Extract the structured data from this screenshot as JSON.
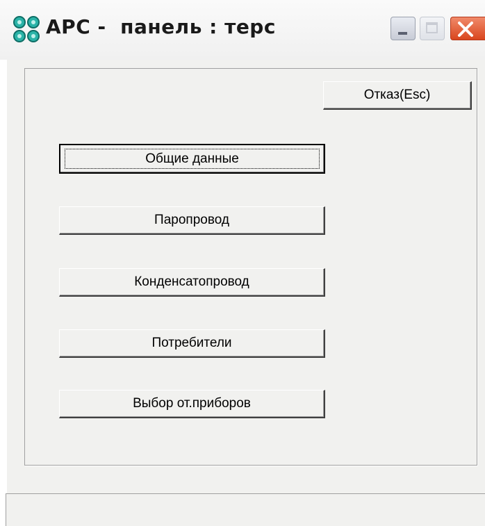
{
  "window": {
    "title": "APC -  панель : терс",
    "icon": "app-clover-icon",
    "controls": {
      "minimize_icon": "minimize-icon",
      "maximize_icon": "maximize-icon",
      "close_icon": "close-icon"
    }
  },
  "buttons": {
    "cancel": "Отказ(Esc)",
    "general_data": "Общие данные",
    "steam_pipe": "Паропровод",
    "condensate_pipe": "Конденсатопровод",
    "consumers": "Потребители",
    "heating_devices": "Выбор от.приборов"
  },
  "statusbar": {
    "text": ""
  },
  "colors": {
    "face": "#f1f1ef",
    "close_button": "#d9461e",
    "app_icon": "#2bb3a8"
  }
}
